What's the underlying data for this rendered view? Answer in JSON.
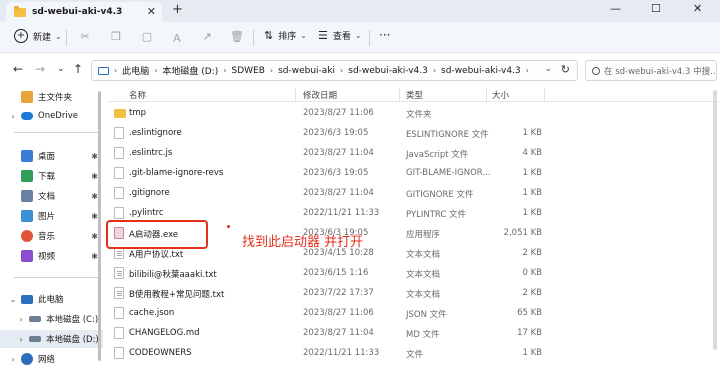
{
  "window": {
    "tab_title": "sd-webui-aki-v4.3",
    "tab_close": "✕",
    "tab_add": "+",
    "controls": [
      "—",
      "☐",
      "✕"
    ]
  },
  "toolbar": {
    "new_label": "新建",
    "new_caret": "⌄",
    "sort_label": "排序",
    "sort_caret": "⌄",
    "view_label": "查看",
    "view_caret": "⌄",
    "more_label": "···"
  },
  "nav": {
    "back": "←",
    "forward": "→",
    "recent": "⌄",
    "up": "↑"
  },
  "address": {
    "crumbs": [
      "此电脑",
      "本地磁盘 (D:)",
      "SDWEB",
      "sd-webui-aki",
      "sd-webui-aki-v4.3",
      "sd-webui-aki-v4.3"
    ],
    "separator": "›",
    "dropdown": "⌄",
    "refresh": "↻"
  },
  "search": {
    "placeholder": "在 sd-webui-aki-v4.3 中搜..."
  },
  "sidebar": {
    "items": [
      {
        "label": "主文件夹",
        "chev": "",
        "icon_color": "#e8a33a"
      },
      {
        "label": "OneDrive",
        "chev": "›",
        "icon_color": "#1f7ad6"
      },
      {
        "label": "桌面",
        "chev": "",
        "icon_color": "#3a7bd5",
        "pin": "📌"
      },
      {
        "label": "下载",
        "chev": "",
        "icon_color": "#2e9e5b",
        "pin": "📌"
      },
      {
        "label": "文档",
        "chev": "",
        "icon_color": "#6b7fa3",
        "pin": "📌"
      },
      {
        "label": "图片",
        "chev": "",
        "icon_color": "#3b8fd6",
        "pin": "📌"
      },
      {
        "label": "音乐",
        "chev": "",
        "icon_color": "#e0553a",
        "pin": "📌"
      },
      {
        "label": "视频",
        "chev": "",
        "icon_color": "#8a4fd1",
        "pin": "📌"
      },
      {
        "label": "此电脑",
        "chev": "⌄",
        "icon_color": "#2a6ebd"
      },
      {
        "label": "本地磁盘 (C:)",
        "chev": "›",
        "icon_color": "#6e7f96"
      },
      {
        "label": "本地磁盘 (D:)",
        "chev": "›",
        "icon_color": "#6e7f96"
      },
      {
        "label": "网络",
        "chev": "›",
        "icon_color": "#2a6ebd"
      }
    ]
  },
  "columns": {
    "name": "名称",
    "date": "修改日期",
    "type": "类型",
    "size": "大小"
  },
  "files": [
    {
      "name": "tmp",
      "date": "2023/8/27 11:06",
      "type": "文件夹",
      "size": "",
      "icon": "folder"
    },
    {
      "name": ".eslintignore",
      "date": "2023/6/3 19:05",
      "type": "ESLINTIGNORE 文件",
      "size": "1 KB",
      "icon": "file"
    },
    {
      "name": ".eslintrc.js",
      "date": "2023/8/27 11:04",
      "type": "JavaScript 文件",
      "size": "4 KB",
      "icon": "file"
    },
    {
      "name": ".git-blame-ignore-revs",
      "date": "2023/6/3 19:05",
      "type": "GIT-BLAME-IGNOR...",
      "size": "1 KB",
      "icon": "file"
    },
    {
      "name": ".gitignore",
      "date": "2023/8/27 11:04",
      "type": "GITIGNORE 文件",
      "size": "1 KB",
      "icon": "file"
    },
    {
      "name": ".pylintrc",
      "date": "2022/11/21 11:33",
      "type": "PYLINTRC 文件",
      "size": "1 KB",
      "icon": "file"
    },
    {
      "name": "A启动器.exe",
      "date": "2023/6/3 19:05",
      "type": "应用程序",
      "size": "2,051 KB",
      "icon": "exe"
    },
    {
      "name": "A用户协议.txt",
      "date": "2023/4/15 10:28",
      "type": "文本文档",
      "size": "2 KB",
      "icon": "txt"
    },
    {
      "name": "bilibili@秋葉aaaki.txt",
      "date": "2023/6/15 1:16",
      "type": "文本文档",
      "size": "0 KB",
      "icon": "txt"
    },
    {
      "name": "B使用教程+常见问题.txt",
      "date": "2023/7/22 17:37",
      "type": "文本文档",
      "size": "2 KB",
      "icon": "txt"
    },
    {
      "name": "cache.json",
      "date": "2023/8/27 11:06",
      "type": "JSON 文件",
      "size": "65 KB",
      "icon": "file"
    },
    {
      "name": "CHANGELOG.md",
      "date": "2023/8/27 11:04",
      "type": "MD 文件",
      "size": "17 KB",
      "icon": "file"
    },
    {
      "name": "CODEOWNERS",
      "date": "2022/11/21 11:33",
      "type": "文件",
      "size": "1 KB",
      "icon": "file"
    }
  ],
  "annotation": {
    "text": "找到此启动器 并打开",
    "color": "#e2301d"
  }
}
